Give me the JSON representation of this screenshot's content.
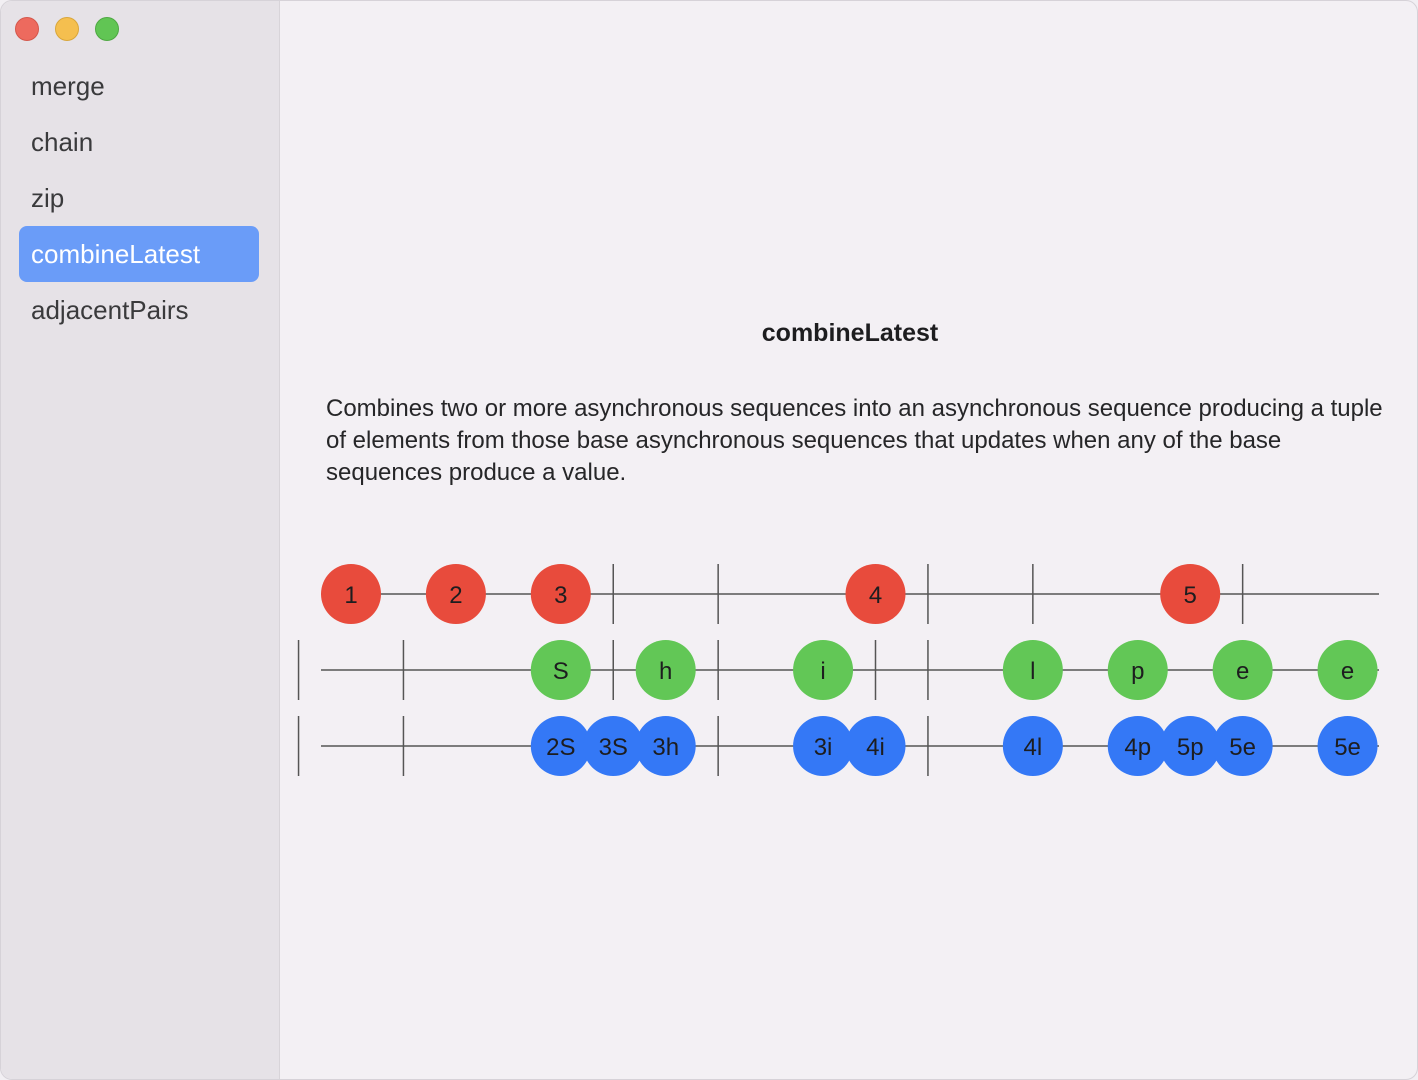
{
  "window": {
    "controls": [
      "close",
      "minimize",
      "zoom"
    ]
  },
  "sidebar": {
    "items": [
      {
        "label": "merge",
        "active": false
      },
      {
        "label": "chain",
        "active": false
      },
      {
        "label": "zip",
        "active": false
      },
      {
        "label": "combineLatest",
        "active": true
      },
      {
        "label": "adjacentPairs",
        "active": false
      }
    ]
  },
  "main": {
    "title": "combineLatest",
    "description": "Combines two or more asynchronous sequences into an asynchronous sequence producing a tuple of elements from those base asynchronous sequences that updates when any of the base sequences produce a value."
  },
  "colors": {
    "sequence1": "#e84b3c",
    "sequence2": "#62c756",
    "result": "#3478f6",
    "line": "#555555",
    "selection": "#6a9cf8"
  },
  "diagram": {
    "rows": [
      {
        "name": "sequence1",
        "ticks": [
          3,
          4,
          6,
          7,
          9
        ],
        "events": [
          {
            "slot": 0,
            "label": "1"
          },
          {
            "slot": 1,
            "label": "2"
          },
          {
            "slot": 2,
            "label": "3"
          },
          {
            "slot": 5,
            "label": "4"
          },
          {
            "slot": 8,
            "label": "5"
          }
        ]
      },
      {
        "name": "sequence2",
        "ticks": [
          0,
          1,
          2.5,
          3,
          4,
          5.5,
          6,
          7,
          8,
          9
        ],
        "events": [
          {
            "slot": 2,
            "label": "S"
          },
          {
            "slot": 3,
            "label": "h"
          },
          {
            "slot": 4.5,
            "label": "i"
          },
          {
            "slot": 6.5,
            "label": "l"
          },
          {
            "slot": 7.5,
            "label": "p"
          },
          {
            "slot": 8.5,
            "label": "e"
          },
          {
            "slot": 9.5,
            "label": "e"
          }
        ]
      },
      {
        "name": "result",
        "ticks": [
          0,
          1,
          3,
          4,
          6,
          7,
          9
        ],
        "events": [
          {
            "slot": 2,
            "label": "2S"
          },
          {
            "slot": 2.5,
            "label": "3S"
          },
          {
            "slot": 3,
            "label": "3h"
          },
          {
            "slot": 4.5,
            "label": "3i"
          },
          {
            "slot": 5,
            "label": "4i"
          },
          {
            "slot": 6.5,
            "label": "4l"
          },
          {
            "slot": 7.5,
            "label": "4p"
          },
          {
            "slot": 8,
            "label": "5p"
          },
          {
            "slot": 8.5,
            "label": "5e"
          },
          {
            "slot": 9.5,
            "label": "5e"
          }
        ]
      }
    ]
  }
}
